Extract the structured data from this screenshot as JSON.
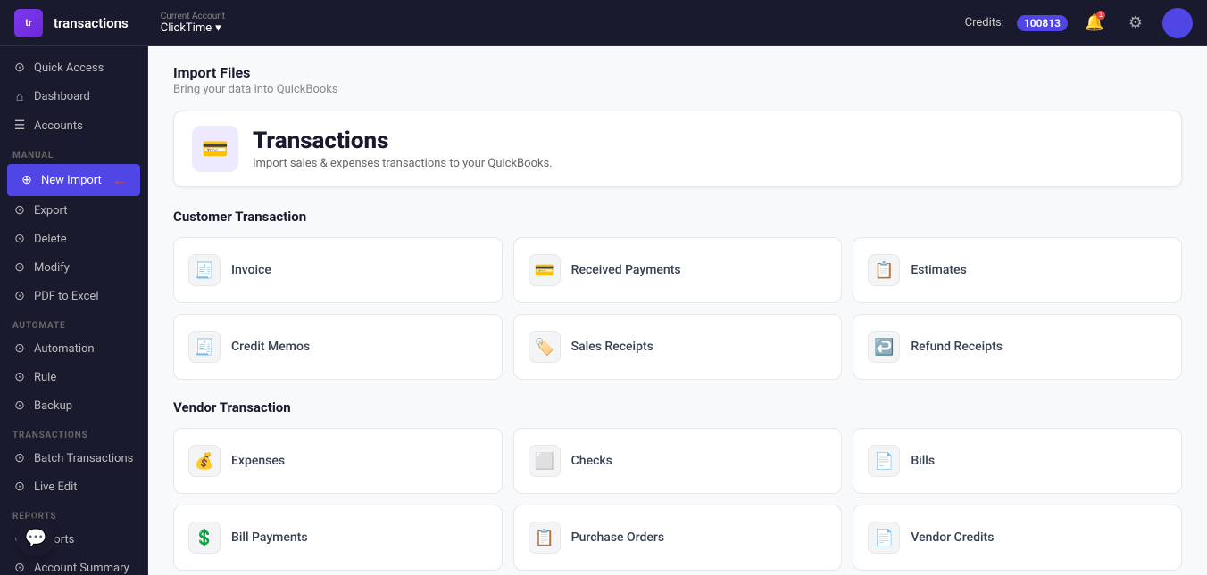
{
  "topnav": {
    "logo_text": "tr",
    "brand": "transactions",
    "account_label": "Current Account",
    "account_name": "ClickTime",
    "credits_label": "Credits:",
    "credits_value": "100813",
    "notif_count": "1"
  },
  "sidebar": {
    "items": [
      {
        "id": "quick-access",
        "label": "Quick Access",
        "icon": "⊙",
        "section": false
      },
      {
        "id": "dashboard",
        "label": "Dashboard",
        "icon": "⌂",
        "section": false
      },
      {
        "id": "accounts",
        "label": "Accounts",
        "icon": "☰",
        "section": false
      },
      {
        "id": "manual-section",
        "label": "MANUAL",
        "section": true
      },
      {
        "id": "new-import",
        "label": "New Import",
        "icon": "⊕",
        "section": false,
        "active": true
      },
      {
        "id": "export",
        "label": "Export",
        "icon": "⊙",
        "section": false
      },
      {
        "id": "delete",
        "label": "Delete",
        "icon": "⊙",
        "section": false
      },
      {
        "id": "modify",
        "label": "Modify",
        "icon": "⊙",
        "section": false
      },
      {
        "id": "pdf-to-excel",
        "label": "PDF to Excel",
        "icon": "⊙",
        "section": false
      },
      {
        "id": "automate-section",
        "label": "AUTOMATE",
        "section": true
      },
      {
        "id": "automation",
        "label": "Automation",
        "icon": "⊙",
        "section": false
      },
      {
        "id": "rule",
        "label": "Rule",
        "icon": "⊙",
        "section": false
      },
      {
        "id": "backup",
        "label": "Backup",
        "icon": "⊙",
        "section": false
      },
      {
        "id": "transactions-section",
        "label": "TRANSACTIONS",
        "section": true
      },
      {
        "id": "batch-transactions",
        "label": "Batch Transactions",
        "icon": "⊙",
        "section": false
      },
      {
        "id": "live-edit",
        "label": "Live Edit",
        "icon": "⊙",
        "section": false
      },
      {
        "id": "reports-section",
        "label": "REPORTS",
        "section": true
      },
      {
        "id": "reports",
        "label": "Reports",
        "icon": "⊙",
        "section": false
      },
      {
        "id": "account-summary",
        "label": "Account Summary",
        "icon": "⊙",
        "section": false
      }
    ]
  },
  "main": {
    "page_title": "Import Files",
    "page_subtitle": "Bring your data into QuickBooks",
    "hero": {
      "title": "Transactions",
      "description": "Import sales & expenses transactions to your QuickBooks."
    },
    "customer_section": "Customer Transaction",
    "customer_cards": [
      {
        "id": "invoice",
        "label": "Invoice",
        "icon": "🧾"
      },
      {
        "id": "received-payments",
        "label": "Received Payments",
        "icon": "💳"
      },
      {
        "id": "estimates",
        "label": "Estimates",
        "icon": "📋"
      },
      {
        "id": "credit-memos",
        "label": "Credit Memos",
        "icon": "🧾"
      },
      {
        "id": "sales-receipts",
        "label": "Sales Receipts",
        "icon": "🏷️"
      },
      {
        "id": "refund-receipts",
        "label": "Refund Receipts",
        "icon": "↩️"
      }
    ],
    "vendor_section": "Vendor Transaction",
    "vendor_cards": [
      {
        "id": "expenses",
        "label": "Expenses",
        "icon": "💰"
      },
      {
        "id": "checks",
        "label": "Checks",
        "icon": "⬜"
      },
      {
        "id": "bills",
        "label": "Bills",
        "icon": "📄"
      },
      {
        "id": "bill-payments",
        "label": "Bill Payments",
        "icon": "💲"
      },
      {
        "id": "purchase-orders",
        "label": "Purchase Orders",
        "icon": "📋"
      },
      {
        "id": "vendor-credits",
        "label": "Vendor Credits",
        "icon": "📄"
      }
    ]
  }
}
